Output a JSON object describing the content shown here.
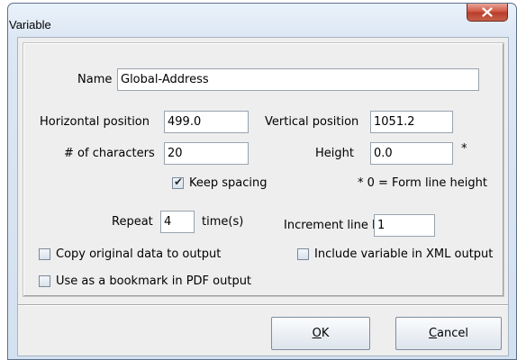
{
  "window": {
    "title": "Variable"
  },
  "name": {
    "label": "Name",
    "value": "Global-Address"
  },
  "horizontal_position": {
    "label": "Horizontal position",
    "value": "499.0"
  },
  "vertical_position": {
    "label": "Vertical position",
    "value": "1051.2"
  },
  "num_characters": {
    "label": "# of characters",
    "value": "20"
  },
  "height": {
    "label": "Height",
    "value": "0.0",
    "asterisk": "*"
  },
  "keep_spacing": {
    "label": "Keep spacing",
    "checked": true
  },
  "form_line_note": "* 0 = Form line height",
  "repeat": {
    "label": "Repeat",
    "value": "4",
    "suffix": "time(s)"
  },
  "increment_line": {
    "label": "Increment line by",
    "value": "1"
  },
  "copy_original": {
    "label": "Copy original data to output",
    "checked": false
  },
  "include_xml": {
    "label": "Include variable in XML output",
    "checked": false
  },
  "bookmark_pdf": {
    "label": "Use as a bookmark in PDF output",
    "checked": false
  },
  "buttons": {
    "ok": {
      "mnemonic": "O",
      "rest": "K"
    },
    "cancel": {
      "mnemonic": "C",
      "rest": "ancel"
    }
  }
}
